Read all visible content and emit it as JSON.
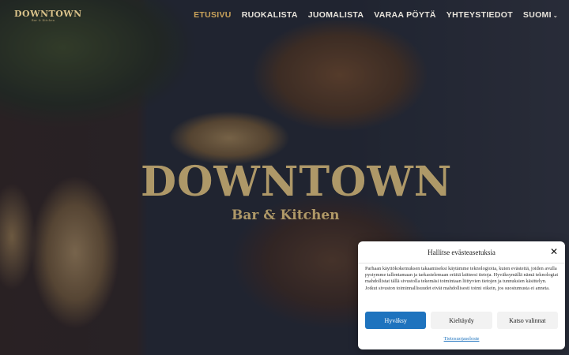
{
  "header": {
    "logo": "DOWNTOWN",
    "logo_sub": "Bar & Kitchen",
    "nav": [
      {
        "label": "ETUSIVU",
        "active": true
      },
      {
        "label": "RUOKALISTA"
      },
      {
        "label": "JUOMALISTA"
      },
      {
        "label": "VARAA PÖYTÄ"
      },
      {
        "label": "YHTEYSTIEDOT"
      },
      {
        "label": "SUOMI"
      }
    ],
    "language_chevron": "⌄"
  },
  "hero": {
    "title": "DOWNTOWN",
    "subtitle": "Bar & Kitchen"
  },
  "cookie_modal": {
    "title": "Hallitse evästeasetuksia",
    "close": "✕",
    "body": "Parhaan käyttökokemuksen takaamiseksi käytämme teknologioita, kuten evästeitä, joiden avulla pystymme tallentamaan ja tarkastelemaan eräitä laitteesi tietoja. Hyväksymällä nämä teknologiat mahdollistat tällä sivustolla tekemäsi toimintaan liittyvien tietojen ja tunnuksien käsittelyn. Jotkut sivuston toiminnallisuudet eivät mahdollisesti toimi oikein, jos suostumusta ei anneta.",
    "accept": "Hyväksy",
    "deny": "Kieltäydy",
    "preferences": "Katso valinnat",
    "policy_link": "Tietosuojaseloste"
  },
  "colors": {
    "accent_gold": "#c9a25a",
    "primary_button": "#1e73be"
  }
}
